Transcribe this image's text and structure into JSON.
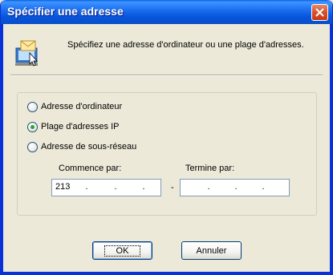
{
  "window": {
    "title": "Spécifier une adresse"
  },
  "header": {
    "description": "Spécifiez une adresse d'ordinateur ou une plage d'adresses."
  },
  "address_type": {
    "options": [
      {
        "label": "Adresse d'ordinateur",
        "checked": false
      },
      {
        "label": "Plage d'adresses IP",
        "checked": true
      },
      {
        "label": "Adresse de sous-réseau",
        "checked": false
      }
    ]
  },
  "range": {
    "start_label": "Commence par:",
    "end_label": "Termine par:",
    "start_octets": [
      "213",
      "",
      "",
      ""
    ],
    "end_octets": [
      "",
      "",
      "",
      ""
    ],
    "dot": ".",
    "separator": "-"
  },
  "buttons": {
    "ok": "OK",
    "cancel": "Annuler"
  },
  "icons": {
    "close": "close-icon",
    "header": "network-address-icon"
  },
  "colors": {
    "titlebar": "#0755db",
    "close": "#d9532e",
    "radio_dot": "#2fa12f"
  }
}
